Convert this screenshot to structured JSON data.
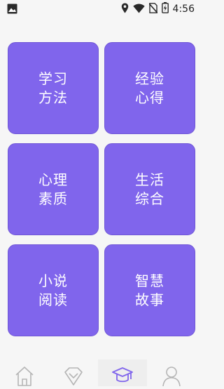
{
  "status_bar": {
    "time": "4:56",
    "icons": [
      "image-icon",
      "location-icon",
      "wifi-icon",
      "no-sim-icon",
      "battery-charging-icon"
    ]
  },
  "colors": {
    "tile": "#8065ec",
    "tile_border": "#7057d6",
    "background": "#f6f6f6",
    "nav_icon": "#b5b5b5",
    "nav_icon_active": "#8065ec"
  },
  "tiles": [
    {
      "label": "学习\n方法"
    },
    {
      "label": "经验\n心得"
    },
    {
      "label": "心理\n素质"
    },
    {
      "label": "生活\n综合"
    },
    {
      "label": "小说\n阅读"
    },
    {
      "label": "智慧\n故事"
    }
  ],
  "bottom_nav": {
    "items": [
      {
        "icon": "home-icon"
      },
      {
        "icon": "diamond-icon"
      },
      {
        "icon": "graduation-cap-icon",
        "active": true
      },
      {
        "icon": "profile-icon"
      }
    ]
  }
}
